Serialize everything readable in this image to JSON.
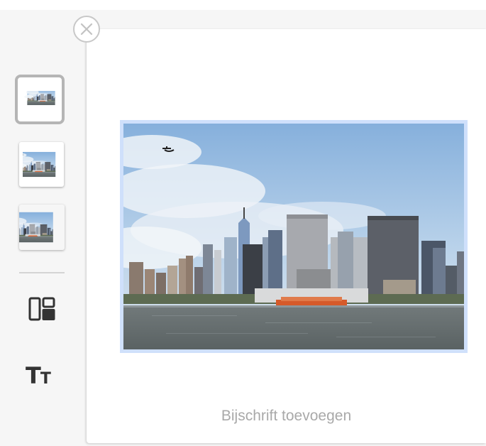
{
  "editor": {
    "caption_placeholder": "Bijschrift toevoegen"
  },
  "sidebar": {
    "thumbnails": [
      {
        "name": "layout-thumbnail-framed",
        "selected": true
      },
      {
        "name": "layout-thumbnail-bordered",
        "selected": false
      },
      {
        "name": "layout-thumbnail-full",
        "selected": false
      }
    ],
    "tools": [
      {
        "icon": "layout-icon"
      },
      {
        "icon": "text-style-icon",
        "glyph_large": "T",
        "glyph_small": "T"
      }
    ]
  },
  "icons": {
    "close": "close-icon"
  },
  "colors": {
    "selected_border": "#b5b5b5",
    "photo_frame": "#cfe0fb",
    "caption_text": "#a9a9a9",
    "icon_dark": "#333333"
  }
}
